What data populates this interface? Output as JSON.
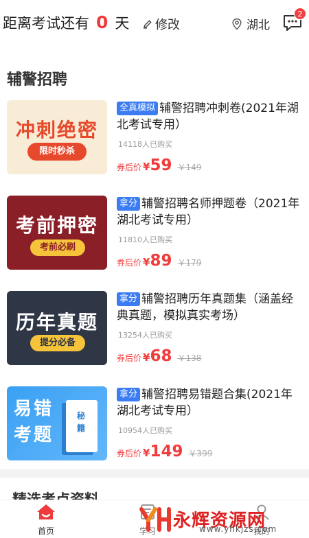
{
  "topbar": {
    "countdown_prefix": "距离考试还有",
    "countdown_days": "0",
    "countdown_suffix": "天",
    "modify_label": "修改",
    "region": "湖北",
    "message_badge": "2"
  },
  "section": {
    "title": "辅警招聘"
  },
  "products": [
    {
      "cover_main": "冲刺绝密",
      "cover_sub": "限时秒杀",
      "tag": "全真模拟",
      "title": "辅警招聘冲刺卷(2021年湖北考试专用）",
      "bought": "14118人已购买",
      "price_label": "券后价",
      "currency": "¥",
      "price": "59",
      "original_price": "￥149"
    },
    {
      "cover_main": "考前押密",
      "cover_sub": "考前必刷",
      "tag": "拿分",
      "title": "辅警招聘名师押题卷（2021年湖北考试专用）",
      "bought": "11810人已购买",
      "price_label": "券后价",
      "currency": "¥",
      "price": "89",
      "original_price": "￥179"
    },
    {
      "cover_main": "历年真题",
      "cover_sub": "提分必备",
      "tag": "拿分",
      "title": "辅警招聘历年真题集（涵盖经典真题，模拟真实考场）",
      "bought": "13254人已购买",
      "price_label": "券后价",
      "currency": "¥",
      "price": "68",
      "original_price": "￥138"
    },
    {
      "cover_main": "易错考题",
      "cover_sub": "秘籍",
      "tag": "拿分",
      "title": "辅警招聘易错题合集(2021年湖北考试专用）",
      "bought": "10954人已购买",
      "price_label": "券后价",
      "currency": "¥",
      "price": "149",
      "original_price": "￥399"
    }
  ],
  "next_section": {
    "title": "精选考点资料"
  },
  "tabbar": {
    "home": "首页",
    "study": "学习",
    "mine": "我的"
  },
  "watermark": {
    "text": "永辉资源网",
    "url": "www.yhkjzs.com"
  },
  "colors": {
    "accent_red": "#f03c3c",
    "tag_blue": "#3b7cf2"
  }
}
